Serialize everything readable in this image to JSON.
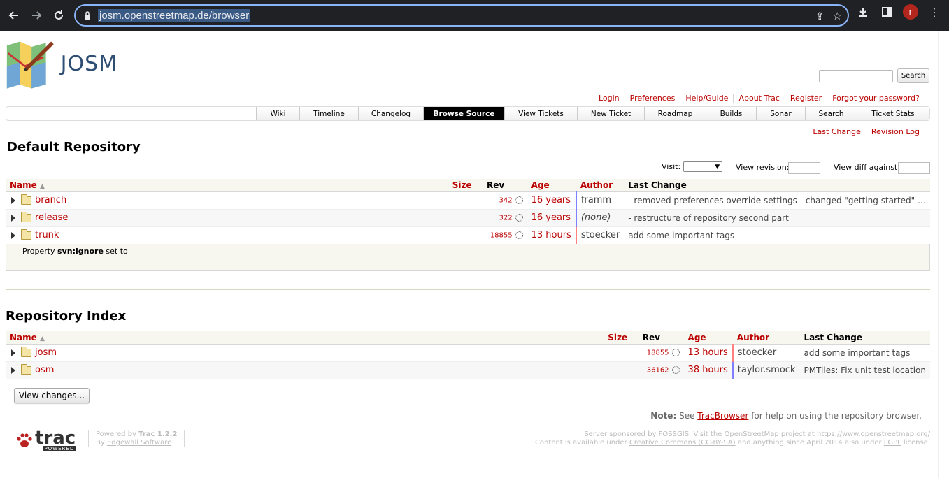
{
  "browser": {
    "url": "josm.openstreetmap.de/browser"
  },
  "site": {
    "logo_text": "JOSM",
    "search_button": "Search",
    "search_value": ""
  },
  "metanav": [
    "Login",
    "Preferences",
    "Help/Guide",
    "About Trac",
    "Register",
    "Forgot your password?"
  ],
  "mainnav": [
    {
      "label": "Wiki",
      "width": 62
    },
    {
      "label": "Timeline",
      "width": 84
    },
    {
      "label": "Changelog",
      "width": 93
    },
    {
      "label": "Browse Source",
      "width": 116,
      "active": true
    },
    {
      "label": "View Tickets",
      "width": 104
    },
    {
      "label": "New Ticket",
      "width": 96
    },
    {
      "label": "Roadmap",
      "width": 88
    },
    {
      "label": "Builds",
      "width": 72
    },
    {
      "label": "Sonar",
      "width": 70
    },
    {
      "label": "Search",
      "width": 74
    },
    {
      "label": "Ticket Stats",
      "width": 103
    }
  ],
  "ctxtnav": [
    "Last Change",
    "Revision Log"
  ],
  "default_repo": {
    "title": "Default Repository",
    "visit_label": "Visit:",
    "view_revision_label": "View revision:",
    "view_diff_label": "View diff against:",
    "headers": {
      "name": "Name",
      "size": "Size",
      "rev": "Rev",
      "age": "Age",
      "author": "Author",
      "change": "Last Change"
    },
    "rows": [
      {
        "name": "branch",
        "size": "",
        "rev": "342",
        "age": "16 years",
        "author": "framm",
        "change": "- removed preferences override settings - changed \"getting started\" …"
      },
      {
        "name": "release",
        "size": "",
        "rev": "322",
        "age": "16 years",
        "author": "(none)",
        "change": "- restructure of repository second part"
      },
      {
        "name": "trunk",
        "size": "",
        "rev": "18855",
        "age": "13 hours",
        "author": "stoecker",
        "change": "add some important tags"
      }
    ],
    "property_prefix": "Property",
    "property_name": "svn:ignore",
    "property_suffix": "set to"
  },
  "repo_index": {
    "title": "Repository Index",
    "headers": {
      "name": "Name",
      "size": "Size",
      "rev": "Rev",
      "age": "Age",
      "author": "Author",
      "change": "Last Change"
    },
    "rows": [
      {
        "name": "josm",
        "size": "",
        "rev": "18855",
        "age": "13 hours",
        "author": "stoecker",
        "change": "add some important tags"
      },
      {
        "name": "osm",
        "size": "",
        "rev": "36162",
        "age": "38 hours",
        "author": "taylor.smock",
        "change": "PMTiles: Fix unit test location"
      }
    ]
  },
  "view_changes_button": "View changes...",
  "note": {
    "bold": "Note:",
    "pre": "See",
    "link": "TracBrowser",
    "post": "for help on using the repository browser."
  },
  "footer": {
    "trac_word": "trac",
    "trac_powered": "POWERED",
    "powered_by": "Powered by",
    "trac_version": "Trac 1.2.2",
    "by": "By",
    "edgewall": "Edgewall Software",
    "sponsor_line1_pre": "Server sponsored by",
    "sponsor_fossgis": "FOSSGIS",
    "sponsor_line1_mid": ". Visit the OpenStreetMap project at",
    "sponsor_osm_url": "https://www.openstreetmap.org/",
    "sponsor_line2_pre": "Content is available under",
    "sponsor_cc": "Creative Commons (CC-BY-SA)",
    "sponsor_line2_mid": "and anything since April 2014 also under",
    "sponsor_lgpl": "LGPL",
    "sponsor_line2_post": "license."
  },
  "colors": {
    "link": "#bb0000",
    "chrome": "#202124",
    "accent": "#8ab4f8",
    "avatar": "#b3261e"
  },
  "icons": [
    "back-icon",
    "forward-icon",
    "reload-icon",
    "lock-icon",
    "share-icon",
    "star-icon",
    "download-icon",
    "sidepanel-icon",
    "menu-icon"
  ]
}
